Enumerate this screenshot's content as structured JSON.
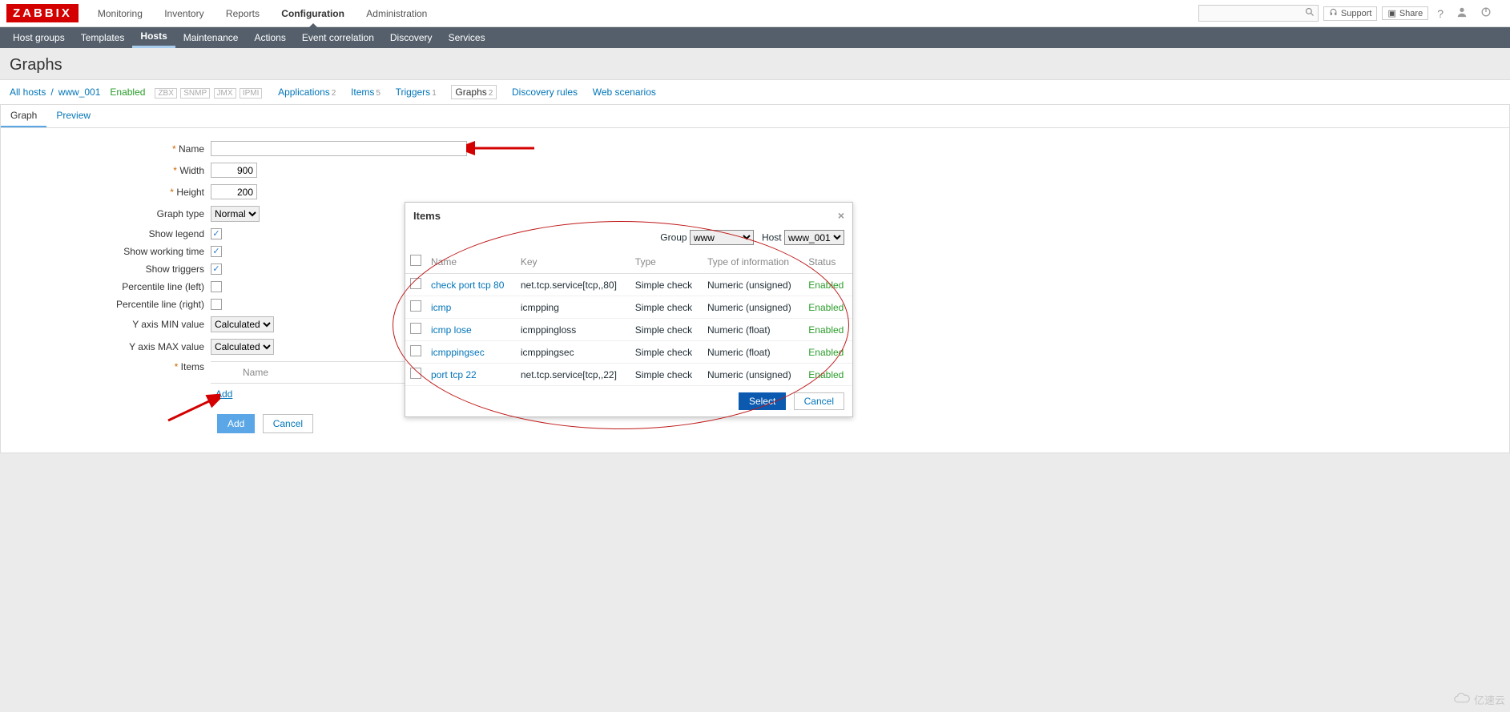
{
  "header": {
    "logo": "ZABBIX",
    "nav": [
      "Monitoring",
      "Inventory",
      "Reports",
      "Configuration",
      "Administration"
    ],
    "nav_active": "Configuration",
    "support": "Support",
    "share": "Share"
  },
  "subnav": {
    "items": [
      "Host groups",
      "Templates",
      "Hosts",
      "Maintenance",
      "Actions",
      "Event correlation",
      "Discovery",
      "Services"
    ],
    "active": "Hosts"
  },
  "page": {
    "title": "Graphs"
  },
  "crumbs": {
    "all_hosts": "All hosts",
    "host": "www_001",
    "status": "Enabled",
    "tags": [
      "ZBX",
      "SNMP",
      "JMX",
      "IPMI"
    ],
    "links": [
      {
        "label": "Applications",
        "count": "2"
      },
      {
        "label": "Items",
        "count": "5"
      },
      {
        "label": "Triggers",
        "count": "1"
      },
      {
        "label": "Graphs",
        "count": "2",
        "active": true
      },
      {
        "label": "Discovery rules"
      },
      {
        "label": "Web scenarios"
      }
    ]
  },
  "tabs": {
    "graph": "Graph",
    "preview": "Preview"
  },
  "form": {
    "name_label": "Name",
    "name_value": "",
    "width_label": "Width",
    "width_value": "900",
    "height_label": "Height",
    "height_value": "200",
    "graphtype_label": "Graph type",
    "graphtype_value": "Normal",
    "showlegend_label": "Show legend",
    "showlegend": true,
    "showworking_label": "Show working time",
    "showworking": true,
    "showtriggers_label": "Show triggers",
    "showtriggers": true,
    "pleft_label": "Percentile line (left)",
    "pleft": false,
    "pright_label": "Percentile line (right)",
    "pright": false,
    "ymin_label": "Y axis MIN value",
    "ymin_value": "Calculated",
    "ymax_label": "Y axis MAX value",
    "ymax_value": "Calculated",
    "items_label": "Items",
    "items_col_name": "Name",
    "add_item": "Add",
    "btn_add": "Add",
    "btn_cancel": "Cancel"
  },
  "modal": {
    "title": "Items",
    "group_label": "Group",
    "group_value": "www",
    "host_label": "Host",
    "host_value": "www_001",
    "cols": {
      "name": "Name",
      "key": "Key",
      "type": "Type",
      "info": "Type of information",
      "status": "Status"
    },
    "rows": [
      {
        "name": "check port tcp 80",
        "key": "net.tcp.service[tcp,,80]",
        "type": "Simple check",
        "info": "Numeric (unsigned)",
        "status": "Enabled"
      },
      {
        "name": "icmp",
        "key": "icmpping",
        "type": "Simple check",
        "info": "Numeric (unsigned)",
        "status": "Enabled"
      },
      {
        "name": "icmp lose",
        "key": "icmppingloss",
        "type": "Simple check",
        "info": "Numeric (float)",
        "status": "Enabled"
      },
      {
        "name": "icmppingsec",
        "key": "icmppingsec",
        "type": "Simple check",
        "info": "Numeric (float)",
        "status": "Enabled"
      },
      {
        "name": "port tcp 22",
        "key": "net.tcp.service[tcp,,22]",
        "type": "Simple check",
        "info": "Numeric (unsigned)",
        "status": "Enabled"
      }
    ],
    "select": "Select",
    "cancel": "Cancel"
  },
  "watermark": "亿速云"
}
